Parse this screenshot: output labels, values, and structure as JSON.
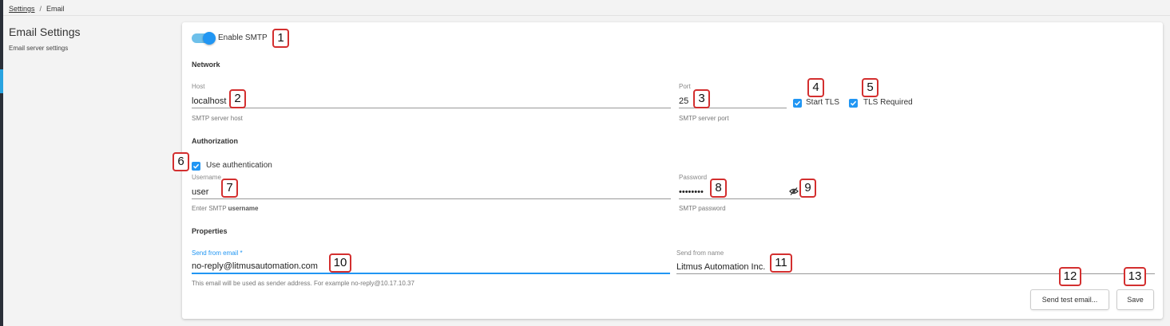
{
  "breadcrumb": {
    "root": "Settings",
    "separator": "/",
    "current": "Email"
  },
  "sidebar": {
    "title": "Email Settings",
    "description": "Email server settings"
  },
  "smtp": {
    "enable_label": "Enable SMTP",
    "enabled": true
  },
  "network": {
    "title": "Network",
    "host": {
      "label": "Host",
      "value": "localhost",
      "hint": "SMTP server host"
    },
    "port": {
      "label": "Port",
      "value": "25",
      "hint": "SMTP server port"
    },
    "start_tls": {
      "label": "Start TLS",
      "checked": true
    },
    "tls_required": {
      "label": "TLS Required",
      "checked": true
    }
  },
  "authorization": {
    "title": "Authorization",
    "use_auth": {
      "label": "Use authentication",
      "checked": true
    },
    "username": {
      "label": "Username",
      "value": "user",
      "hint_prefix": "Enter SMTP",
      "hint_bold": "username"
    },
    "password": {
      "label": "Password",
      "value": "••••••••",
      "hint": "SMTP password"
    }
  },
  "properties": {
    "title": "Properties",
    "send_from_email": {
      "label": "Send from email *",
      "value": "no-reply@litmusautomation.com",
      "hint": "This email will be used as sender address. For example no-reply@10.17.10.37"
    },
    "send_from_name": {
      "label": "Send from name",
      "value": "Litmus Automation Inc."
    }
  },
  "actions": {
    "send_test": "Send test email...",
    "save": "Save"
  },
  "annotations": [
    "1",
    "2",
    "3",
    "4",
    "5",
    "6",
    "7",
    "8",
    "9",
    "10",
    "11",
    "12",
    "13"
  ],
  "icons": {
    "toggle": "toggle-icon",
    "check": "check-icon",
    "eye": "eye-off-icon"
  },
  "colors": {
    "accent": "#2196f3",
    "toggle_track": "#6ec0ea",
    "annotation_border": "#d32f2f",
    "sidebar_dark": "#2a2f38"
  }
}
